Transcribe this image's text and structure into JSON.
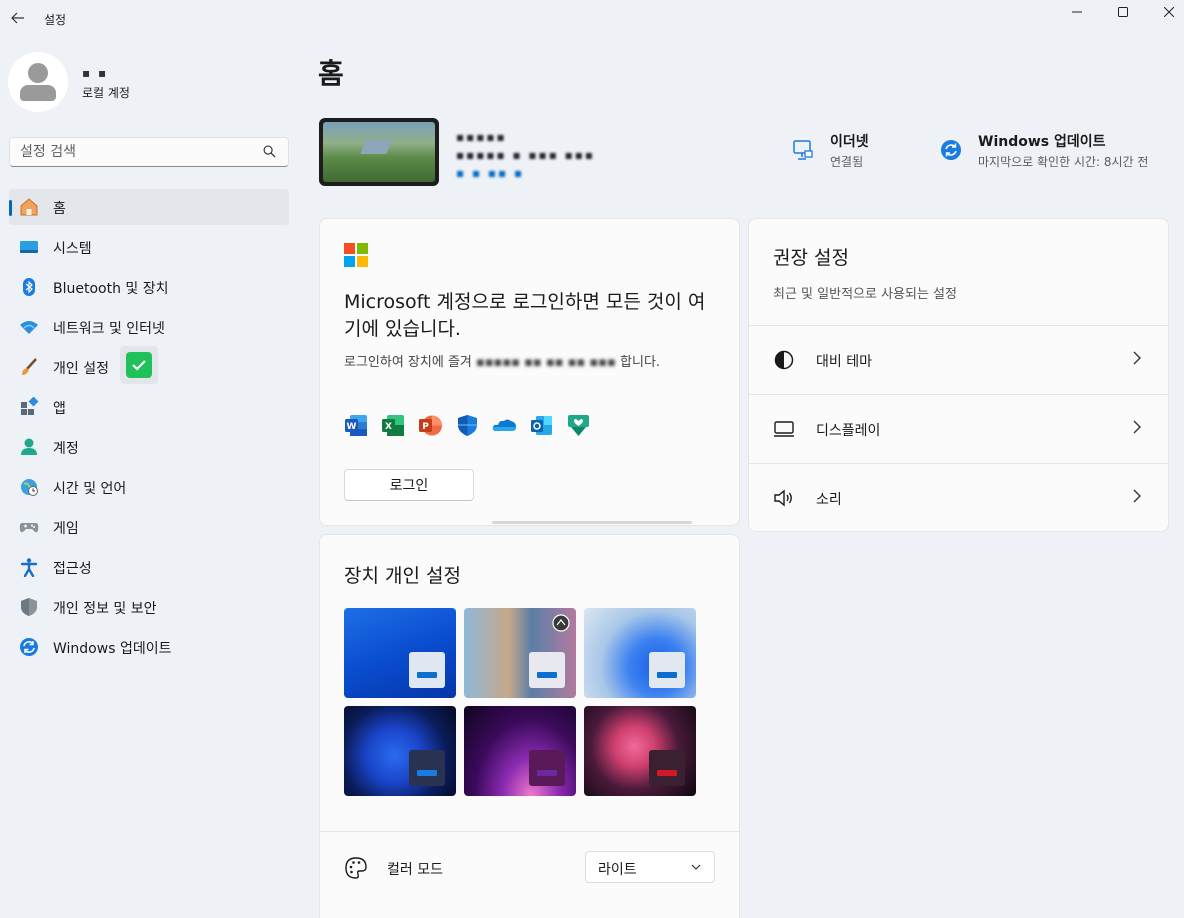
{
  "window": {
    "title": "설정",
    "back_label": "←",
    "minimize": "—",
    "maximize": "☐",
    "close": "✕"
  },
  "profile": {
    "name": "▪ ▪",
    "account_type": "로컬 계정"
  },
  "search": {
    "placeholder": "설정 검색"
  },
  "sidebar": {
    "items": [
      {
        "label": "홈",
        "icon": "home-icon",
        "active": true
      },
      {
        "label": "시스템",
        "icon": "system-icon"
      },
      {
        "label": "Bluetooth 및 장치",
        "icon": "bluetooth-icon"
      },
      {
        "label": "네트워크 및 인터넷",
        "icon": "network-icon"
      },
      {
        "label": "개인 설정",
        "icon": "brush-icon"
      },
      {
        "label": "앱",
        "icon": "apps-icon"
      },
      {
        "label": "계정",
        "icon": "account-icon"
      },
      {
        "label": "시간 및 언어",
        "icon": "time-language-icon"
      },
      {
        "label": "게임",
        "icon": "gamepad-icon"
      },
      {
        "label": "접근성",
        "icon": "accessibility-icon"
      },
      {
        "label": "개인 정보 및 보안",
        "icon": "shield-icon"
      },
      {
        "label": "Windows 업데이트",
        "icon": "update-icon"
      }
    ]
  },
  "main": {
    "title": "홈",
    "device": {
      "name_blurred": "▪▪▪▪▪",
      "model_blurred": "▪▪▪▪▪ ▪ ▪▪▪ ▪▪▪",
      "rename_blurred": "▪ ▪ ▪▪ ▪"
    },
    "status": {
      "ethernet_title": "이더넷",
      "ethernet_sub": "연결됨",
      "update_title": "Windows 업데이트",
      "update_sub": "마지막으로 확인한 시간: 8시간 전"
    },
    "ms_card": {
      "title": "Microsoft 계정으로 로그인하면 모든 것이 여기에 있습니다.",
      "desc_visible": "로그인하여 장치에 즐겨",
      "desc_blurred": "▪▪▪▪▪ ▪▪ ▪▪ ▪▪ ▪▪▪",
      "desc_end": "합니다.",
      "login_label": "로그인",
      "apps": [
        "word-icon",
        "excel-icon",
        "powerpoint-icon",
        "defender-icon",
        "onedrive-icon",
        "outlook-icon",
        "family-icon"
      ]
    },
    "recommended": {
      "title": "권장 설정",
      "subtitle": "최근 및 일반적으로 사용되는 설정",
      "items": [
        {
          "label": "대비 테마",
          "icon": "contrast-icon"
        },
        {
          "label": "디스플레이",
          "icon": "display-icon"
        },
        {
          "label": "소리",
          "icon": "sound-icon"
        }
      ]
    },
    "personalize": {
      "title": "장치 개인 설정",
      "color_mode_label": "컬러 모드",
      "color_mode_value": "라이트"
    }
  },
  "colors": {
    "accent": "#0067c0",
    "background": "#eef2f6",
    "card": "#fbfbfb"
  }
}
